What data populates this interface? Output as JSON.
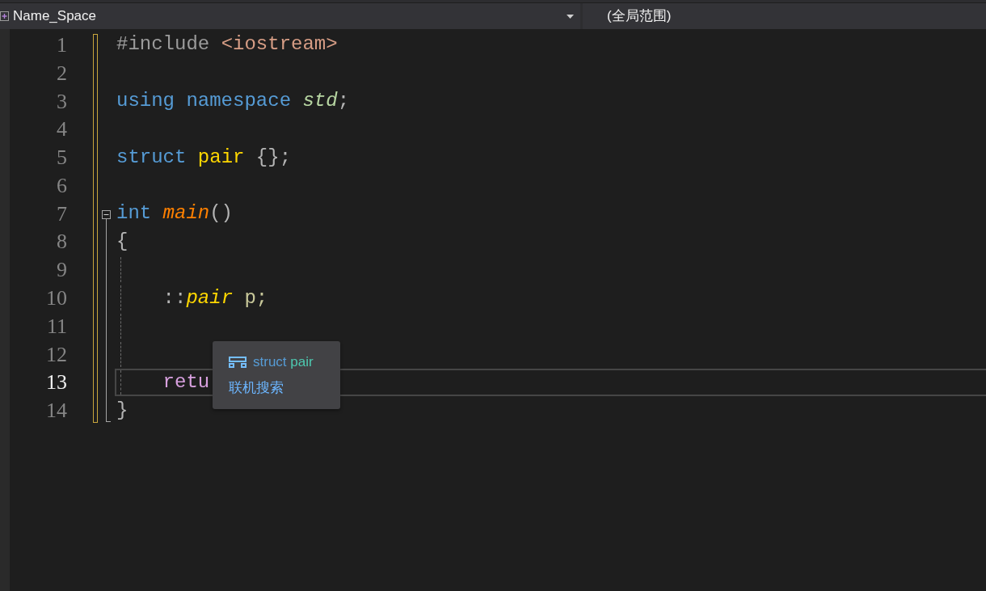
{
  "navigation_bar": {
    "project_dropdown": {
      "value": "Name_Space"
    },
    "scope_dropdown": {
      "value": "(全局范围)"
    }
  },
  "editor": {
    "lines": [
      {
        "number": "1",
        "modified": true,
        "selected": false,
        "kind": "plain",
        "tokens": [
          {
            "text": "#include ",
            "kind": "preprocessor"
          },
          {
            "text": "<iostream>",
            "kind": "string"
          }
        ]
      },
      {
        "number": "2",
        "modified": true,
        "selected": false,
        "kind": "plain"
      },
      {
        "number": "3",
        "modified": true,
        "selected": false,
        "kind": "plain",
        "tokens": [
          {
            "text": "using namespace ",
            "kind": "keyword"
          },
          {
            "text": "std",
            "kind": "namespace"
          },
          {
            "text": ";",
            "kind": "punctuation"
          }
        ]
      },
      {
        "number": "4",
        "modified": true,
        "selected": false,
        "kind": "plain"
      },
      {
        "number": "5",
        "modified": true,
        "selected": false,
        "kind": "plain",
        "tokens": [
          {
            "text": "struct ",
            "kind": "keyword"
          },
          {
            "text": "pair ",
            "kind": "type"
          },
          {
            "text": "{};",
            "kind": "punctuation"
          }
        ]
      },
      {
        "number": "6",
        "modified": true,
        "selected": false,
        "kind": "plain"
      },
      {
        "number": "7",
        "modified": true,
        "selected": false,
        "kind": "header",
        "expanded": true,
        "tokens": [
          {
            "text": "int ",
            "kind": "keyword"
          },
          {
            "text": "main",
            "kind": "function"
          },
          {
            "text": "()",
            "kind": "punctuation"
          }
        ]
      },
      {
        "number": "8",
        "modified": true,
        "selected": false,
        "kind": "body",
        "tokens": [
          {
            "text": "{",
            "kind": "punctuation"
          }
        ]
      },
      {
        "number": "9",
        "modified": true,
        "selected": false,
        "kind": "body",
        "guide": true
      },
      {
        "number": "10",
        "modified": true,
        "selected": false,
        "kind": "body",
        "guide": true,
        "tokens": [
          {
            "text": "    ::",
            "kind": "punctuation"
          },
          {
            "text": "pair",
            "kind": "type-italic"
          },
          {
            "text": " p;",
            "kind": "variable"
          }
        ]
      },
      {
        "number": "11",
        "modified": true,
        "selected": false,
        "kind": "body",
        "guide": true
      },
      {
        "number": "12",
        "modified": true,
        "selected": false,
        "kind": "body",
        "guide": true
      },
      {
        "number": "13",
        "modified": true,
        "selected": true,
        "kind": "body",
        "guide": true,
        "tokens": [
          {
            "text": "    retu",
            "kind": "control"
          }
        ]
      },
      {
        "number": "14",
        "modified": true,
        "selected": false,
        "kind": "footer",
        "tokens": [
          {
            "text": "}",
            "kind": "punctuation"
          }
        ]
      }
    ]
  },
  "quick_info": {
    "items": [
      {
        "kind": "symbol",
        "tokens": [
          {
            "text": "struct",
            "kind": "keyword"
          },
          {
            "text": "pair",
            "kind": "class"
          }
        ]
      },
      {
        "kind": "link",
        "text": "联机搜索"
      }
    ]
  }
}
